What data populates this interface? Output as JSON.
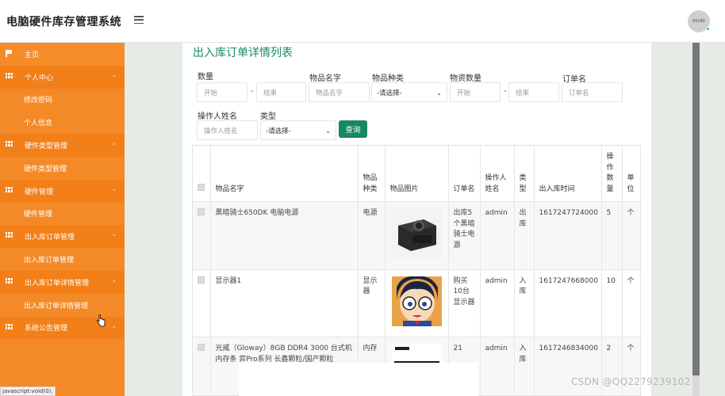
{
  "app": {
    "title": "电脑硬件库存管理系统",
    "avatar_text": "80x80"
  },
  "sidebar": {
    "items": [
      {
        "label": "主页",
        "kind": "home",
        "icon": "flag-icon"
      },
      {
        "label": "个人中心",
        "kind": "head",
        "icon": "grid-icon"
      },
      {
        "label": "修改密码",
        "kind": "sub"
      },
      {
        "label": "个人信息",
        "kind": "sub"
      },
      {
        "label": "硬件类型管理",
        "kind": "head",
        "icon": "grid-icon"
      },
      {
        "label": "硬件类型管理",
        "kind": "sub"
      },
      {
        "label": "硬件管理",
        "kind": "head",
        "icon": "grid-icon"
      },
      {
        "label": "硬件管理",
        "kind": "sub"
      },
      {
        "label": "出入库订单管理",
        "kind": "head",
        "icon": "grid-icon"
      },
      {
        "label": "出入库订单管理",
        "kind": "sub"
      },
      {
        "label": "出入库订单详情管理",
        "kind": "head",
        "icon": "grid-icon"
      },
      {
        "label": "出入库订单详情管理",
        "kind": "sub"
      },
      {
        "label": "系统公告管理",
        "kind": "head",
        "icon": "grid-icon"
      }
    ]
  },
  "page": {
    "title": "出入库订单详情列表"
  },
  "filters": {
    "quantity_label": "数量",
    "quantity_start_placeholder": "开始",
    "quantity_end_placeholder": "结束",
    "item_name_label": "物品名字",
    "item_name_placeholder": "物品名字",
    "item_type_label": "物品种类",
    "item_type_value": "-请选择-",
    "stock_qty_label": "物资数量",
    "stock_start_placeholder": "开始",
    "stock_end_placeholder": "结束",
    "order_name_label": "订单名",
    "order_name_placeholder": "订单名",
    "operator_label": "操作人姓名",
    "operator_placeholder": "操作人姓名",
    "type_label": "类型",
    "type_value": "-请选择-",
    "dash": "-",
    "query_button": "查询"
  },
  "table": {
    "headers": {
      "name": "物品名字",
      "kind": "物品种类",
      "image": "物品图片",
      "order": "订单名",
      "operator": "操作人姓名",
      "type": "类型",
      "time": "出入库时间",
      "qty": "操作数量",
      "unit": "单位"
    },
    "rows": [
      {
        "name": "黑暗骑士650DK 电脑电源",
        "kind": "电源",
        "image": "power-supply-photo",
        "order": "出库5个黑暗骑士电源",
        "operator": "admin",
        "type": "出库",
        "time": "1617247724000",
        "qty": "5",
        "unit": "个"
      },
      {
        "name": "显示器1",
        "kind": "显示器",
        "image": "anime-character-photo",
        "order": "购买10台显示器",
        "operator": "admin",
        "type": "入库",
        "time": "1617247668000",
        "qty": "10",
        "unit": "个"
      },
      {
        "name": "光威（Gloway）8GB DDR4 3000 台式机内存条 弈Pro系列 长鑫颗粒/国产颗粒",
        "kind": "内存",
        "image": "ram-module-photo",
        "order": "21",
        "operator": "admin",
        "type": "入库",
        "time": "1617246834000",
        "qty": "2",
        "unit": "个"
      }
    ]
  },
  "status_bar": {
    "text": "javascript:void(0);"
  },
  "watermark": {
    "text": "CSDN @QQ2279239102"
  },
  "colors": {
    "sidebar": "#f48a27",
    "accent": "#17895f",
    "title": "#1a8a6a"
  }
}
